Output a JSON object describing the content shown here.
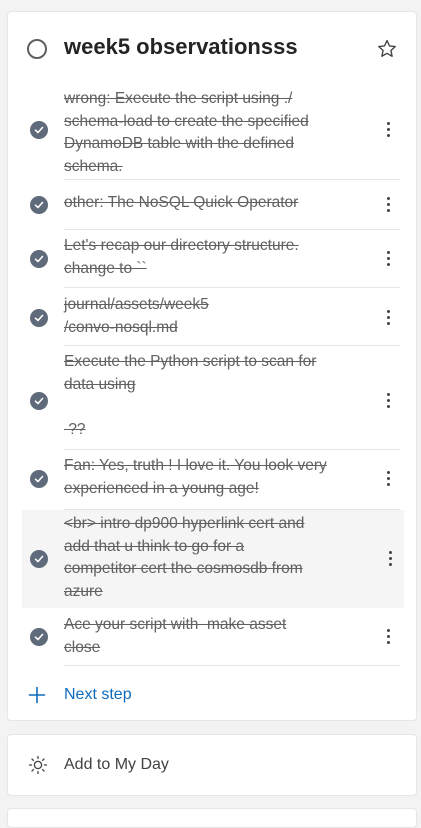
{
  "task": {
    "title": "week5 observationsss"
  },
  "steps": [
    {
      "text": "wrong: Execute the script using ./\nschema-load to create the specified\nDynamoDB table with the defined\nschema.",
      "completed": true
    },
    {
      "text": "other: The NoSQL Quick Operator",
      "completed": true
    },
    {
      "text": "Let's recap our directory structure.\nchange to ``",
      "completed": true
    },
    {
      "text": "journal/assets/week5\n/convo-nosql.md",
      "completed": true
    },
    {
      "text": "Execute the Python script to scan for\ndata using\n\n ??",
      "completed": true
    },
    {
      "text": "Fan: Yes, truth ! I love it. You look very\nexperienced in a young age!",
      "completed": true
    },
    {
      "text": "<br> intro dp900 hyperlink cert and\nadd that u think to go for a\ncompetitor cert the cosmosdb from\nazure",
      "completed": true
    },
    {
      "text": "Ace your script with  make asset\nclose",
      "completed": true
    }
  ],
  "next_step": {
    "label": "Next step"
  },
  "my_day": {
    "label": "Add to My Day"
  },
  "colors": {
    "accent": "#0f6cbd",
    "check_fill": "#5f6b7a"
  }
}
